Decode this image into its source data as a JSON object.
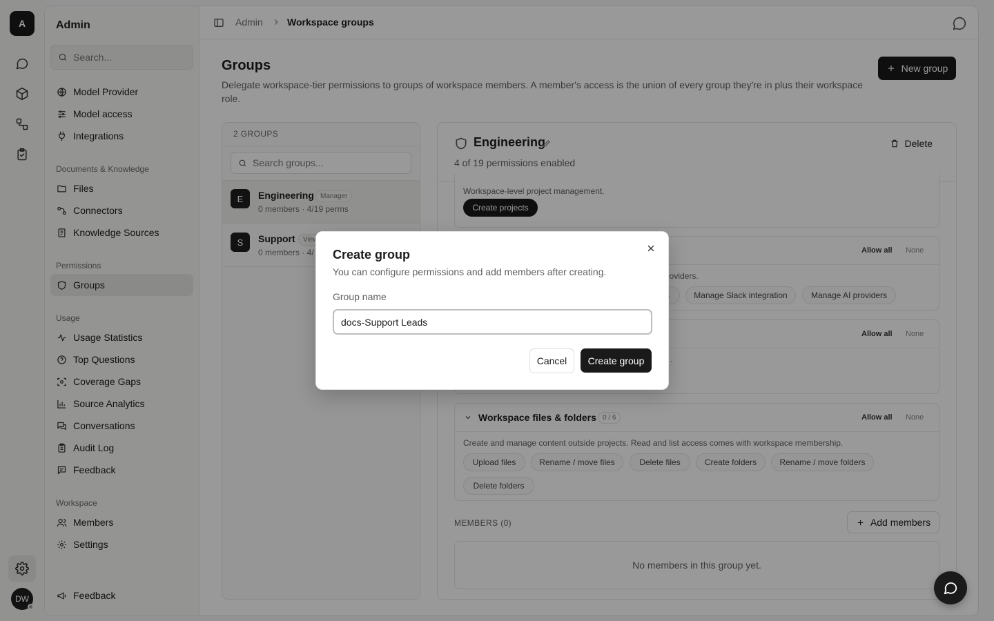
{
  "rail": {
    "logo_letter": "A",
    "avatar_initials": "DW"
  },
  "sidebar": {
    "title": "Admin",
    "search_placeholder": "Search...",
    "top_items": [
      {
        "label": "Model Provider",
        "icon": "globe-icon"
      },
      {
        "label": "Model access",
        "icon": "sliders-icon"
      },
      {
        "label": "Integrations",
        "icon": "plug-icon"
      }
    ],
    "sections": [
      {
        "title": "Documents & Knowledge",
        "items": [
          {
            "label": "Files",
            "icon": "folder-icon"
          },
          {
            "label": "Connectors",
            "icon": "link-icon"
          },
          {
            "label": "Knowledge Sources",
            "icon": "book-icon"
          }
        ]
      },
      {
        "title": "Permissions",
        "items": [
          {
            "label": "Groups",
            "icon": "shield-icon",
            "active": true
          }
        ]
      },
      {
        "title": "Usage",
        "items": [
          {
            "label": "Usage Statistics",
            "icon": "activity-icon"
          },
          {
            "label": "Top Questions",
            "icon": "help-circle-icon"
          },
          {
            "label": "Coverage Gaps",
            "icon": "scan-icon"
          },
          {
            "label": "Source Analytics",
            "icon": "bar-chart-icon"
          },
          {
            "label": "Conversations",
            "icon": "messages-icon"
          },
          {
            "label": "Audit Log",
            "icon": "clipboard-icon"
          },
          {
            "label": "Feedback",
            "icon": "message-square-icon"
          }
        ]
      },
      {
        "title": "Workspace",
        "items": [
          {
            "label": "Members",
            "icon": "users-icon"
          },
          {
            "label": "Settings",
            "icon": "gear-icon"
          }
        ]
      }
    ],
    "footer_item": {
      "label": "Feedback",
      "icon": "megaphone-icon"
    }
  },
  "topbar": {
    "crumb_parent": "Admin",
    "crumb_current": "Workspace groups"
  },
  "main": {
    "title": "Groups",
    "description": "Delegate workspace-tier permissions to groups of workspace members. A member's access is the union of every group they're in plus their workspace role.",
    "new_group_label": "New group"
  },
  "groups_panel": {
    "header": "2 GROUPS",
    "search_placeholder": "Search groups...",
    "groups": [
      {
        "initial": "E",
        "name": "Engineering",
        "badge": "Manager",
        "meta": "0 members · 4/19 perms"
      },
      {
        "initial": "S",
        "name": "Support",
        "badge": "View",
        "meta": "0 members · 4/"
      }
    ]
  },
  "detail": {
    "title": "Engineering",
    "subtitle": "4 of 19 permissions enabled",
    "delete_label": "Delete",
    "card1": {
      "desc": "Workspace-level project management.",
      "chips": [
        {
          "label": "Create projects",
          "on": true
        }
      ]
    },
    "card2": {
      "allow_all": "Allow all",
      "none": "None",
      "desc_tail": "providers.",
      "chips": [
        {
          "label": "s",
          "on": false
        },
        {
          "label": "Manage Slack integration",
          "on": false
        },
        {
          "label": "Manage AI providers",
          "on": false
        }
      ]
    },
    "card3": {
      "allow_all": "Allow all",
      "none": "None",
      "desc_tail": "."
    },
    "card4": {
      "title": "Workspace files & folders",
      "count": "0 / 6",
      "allow_all": "Allow all",
      "none": "None",
      "desc": "Create and manage content outside projects. Read and list access comes with workspace membership.",
      "chips": [
        {
          "label": "Upload files"
        },
        {
          "label": "Rename / move files"
        },
        {
          "label": "Delete files"
        },
        {
          "label": "Create folders"
        },
        {
          "label": "Rename / move folders"
        },
        {
          "label": "Delete folders"
        }
      ]
    },
    "members_label": "MEMBERS (0)",
    "add_members_label": "Add members",
    "members_empty": "No members in this group yet."
  },
  "modal": {
    "title": "Create group",
    "subtitle": "You can configure permissions and add members after creating.",
    "field_label": "Group name",
    "field_value": "docs-Support Leads",
    "cancel_label": "Cancel",
    "create_label": "Create group"
  }
}
